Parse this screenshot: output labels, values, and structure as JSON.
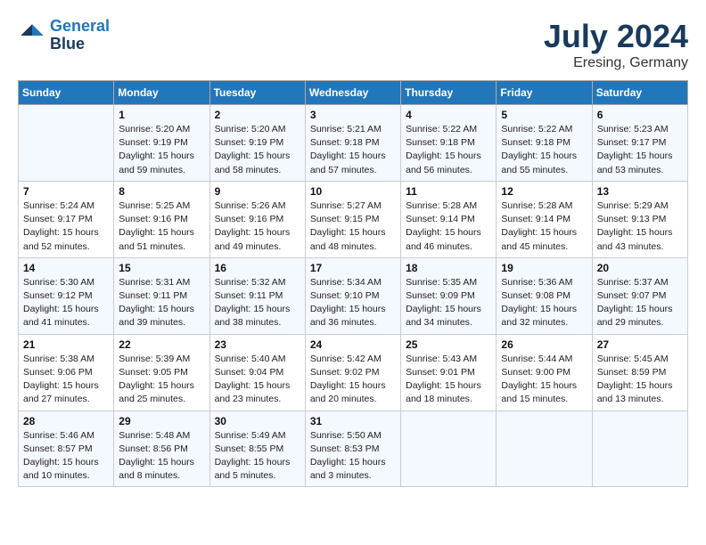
{
  "logo": {
    "line1": "General",
    "line2": "Blue"
  },
  "title": "July 2024",
  "location": "Eresing, Germany",
  "days_of_week": [
    "Sunday",
    "Monday",
    "Tuesday",
    "Wednesday",
    "Thursday",
    "Friday",
    "Saturday"
  ],
  "weeks": [
    [
      {
        "num": "",
        "info": ""
      },
      {
        "num": "1",
        "info": "Sunrise: 5:20 AM\nSunset: 9:19 PM\nDaylight: 15 hours\nand 59 minutes."
      },
      {
        "num": "2",
        "info": "Sunrise: 5:20 AM\nSunset: 9:19 PM\nDaylight: 15 hours\nand 58 minutes."
      },
      {
        "num": "3",
        "info": "Sunrise: 5:21 AM\nSunset: 9:18 PM\nDaylight: 15 hours\nand 57 minutes."
      },
      {
        "num": "4",
        "info": "Sunrise: 5:22 AM\nSunset: 9:18 PM\nDaylight: 15 hours\nand 56 minutes."
      },
      {
        "num": "5",
        "info": "Sunrise: 5:22 AM\nSunset: 9:18 PM\nDaylight: 15 hours\nand 55 minutes."
      },
      {
        "num": "6",
        "info": "Sunrise: 5:23 AM\nSunset: 9:17 PM\nDaylight: 15 hours\nand 53 minutes."
      }
    ],
    [
      {
        "num": "7",
        "info": "Sunrise: 5:24 AM\nSunset: 9:17 PM\nDaylight: 15 hours\nand 52 minutes."
      },
      {
        "num": "8",
        "info": "Sunrise: 5:25 AM\nSunset: 9:16 PM\nDaylight: 15 hours\nand 51 minutes."
      },
      {
        "num": "9",
        "info": "Sunrise: 5:26 AM\nSunset: 9:16 PM\nDaylight: 15 hours\nand 49 minutes."
      },
      {
        "num": "10",
        "info": "Sunrise: 5:27 AM\nSunset: 9:15 PM\nDaylight: 15 hours\nand 48 minutes."
      },
      {
        "num": "11",
        "info": "Sunrise: 5:28 AM\nSunset: 9:14 PM\nDaylight: 15 hours\nand 46 minutes."
      },
      {
        "num": "12",
        "info": "Sunrise: 5:28 AM\nSunset: 9:14 PM\nDaylight: 15 hours\nand 45 minutes."
      },
      {
        "num": "13",
        "info": "Sunrise: 5:29 AM\nSunset: 9:13 PM\nDaylight: 15 hours\nand 43 minutes."
      }
    ],
    [
      {
        "num": "14",
        "info": "Sunrise: 5:30 AM\nSunset: 9:12 PM\nDaylight: 15 hours\nand 41 minutes."
      },
      {
        "num": "15",
        "info": "Sunrise: 5:31 AM\nSunset: 9:11 PM\nDaylight: 15 hours\nand 39 minutes."
      },
      {
        "num": "16",
        "info": "Sunrise: 5:32 AM\nSunset: 9:11 PM\nDaylight: 15 hours\nand 38 minutes."
      },
      {
        "num": "17",
        "info": "Sunrise: 5:34 AM\nSunset: 9:10 PM\nDaylight: 15 hours\nand 36 minutes."
      },
      {
        "num": "18",
        "info": "Sunrise: 5:35 AM\nSunset: 9:09 PM\nDaylight: 15 hours\nand 34 minutes."
      },
      {
        "num": "19",
        "info": "Sunrise: 5:36 AM\nSunset: 9:08 PM\nDaylight: 15 hours\nand 32 minutes."
      },
      {
        "num": "20",
        "info": "Sunrise: 5:37 AM\nSunset: 9:07 PM\nDaylight: 15 hours\nand 29 minutes."
      }
    ],
    [
      {
        "num": "21",
        "info": "Sunrise: 5:38 AM\nSunset: 9:06 PM\nDaylight: 15 hours\nand 27 minutes."
      },
      {
        "num": "22",
        "info": "Sunrise: 5:39 AM\nSunset: 9:05 PM\nDaylight: 15 hours\nand 25 minutes."
      },
      {
        "num": "23",
        "info": "Sunrise: 5:40 AM\nSunset: 9:04 PM\nDaylight: 15 hours\nand 23 minutes."
      },
      {
        "num": "24",
        "info": "Sunrise: 5:42 AM\nSunset: 9:02 PM\nDaylight: 15 hours\nand 20 minutes."
      },
      {
        "num": "25",
        "info": "Sunrise: 5:43 AM\nSunset: 9:01 PM\nDaylight: 15 hours\nand 18 minutes."
      },
      {
        "num": "26",
        "info": "Sunrise: 5:44 AM\nSunset: 9:00 PM\nDaylight: 15 hours\nand 15 minutes."
      },
      {
        "num": "27",
        "info": "Sunrise: 5:45 AM\nSunset: 8:59 PM\nDaylight: 15 hours\nand 13 minutes."
      }
    ],
    [
      {
        "num": "28",
        "info": "Sunrise: 5:46 AM\nSunset: 8:57 PM\nDaylight: 15 hours\nand 10 minutes."
      },
      {
        "num": "29",
        "info": "Sunrise: 5:48 AM\nSunset: 8:56 PM\nDaylight: 15 hours\nand 8 minutes."
      },
      {
        "num": "30",
        "info": "Sunrise: 5:49 AM\nSunset: 8:55 PM\nDaylight: 15 hours\nand 5 minutes."
      },
      {
        "num": "31",
        "info": "Sunrise: 5:50 AM\nSunset: 8:53 PM\nDaylight: 15 hours\nand 3 minutes."
      },
      {
        "num": "",
        "info": ""
      },
      {
        "num": "",
        "info": ""
      },
      {
        "num": "",
        "info": ""
      }
    ]
  ]
}
